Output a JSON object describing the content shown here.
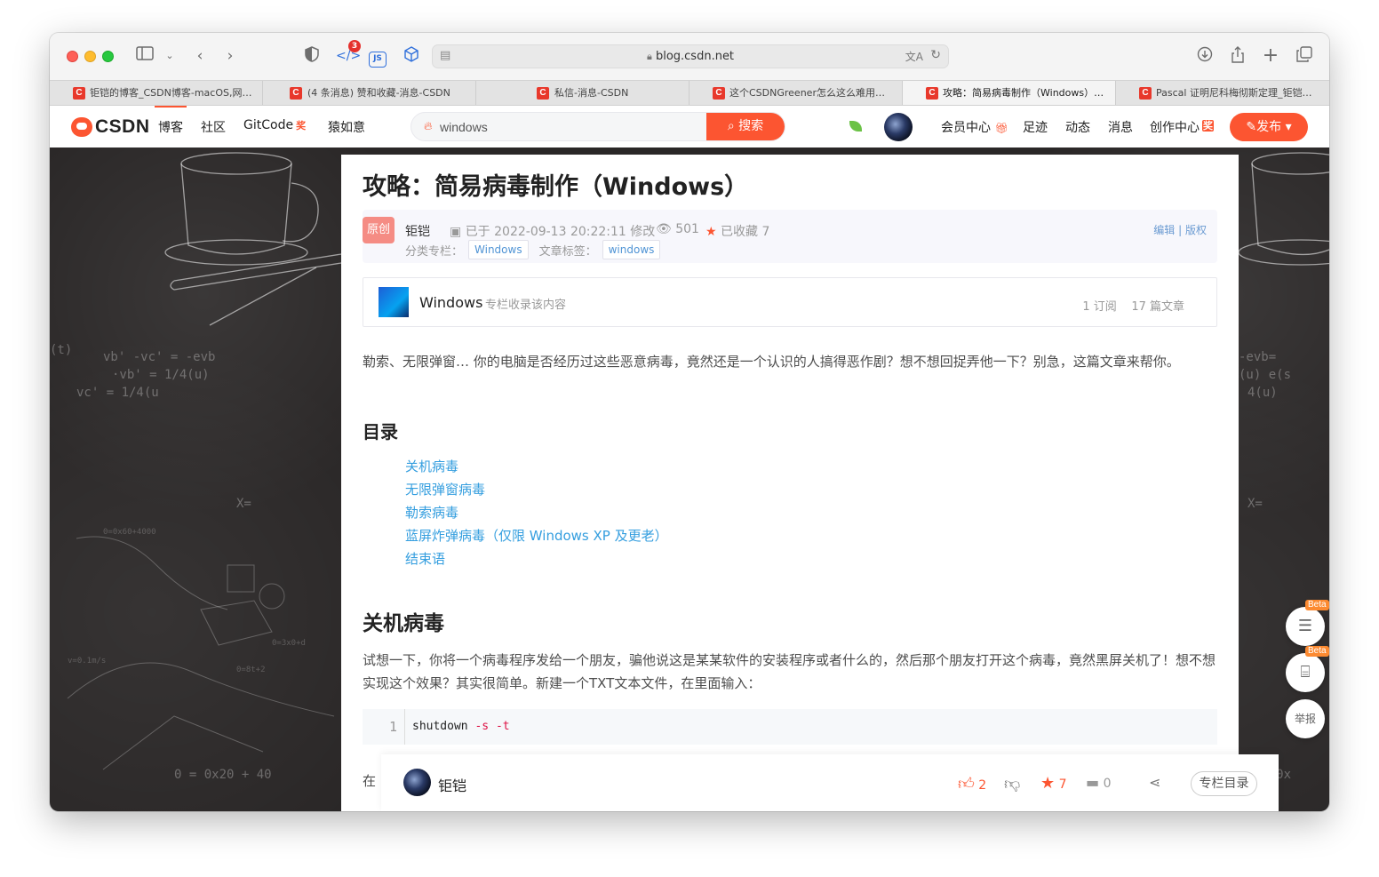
{
  "browser": {
    "address": "blog.csdn.net",
    "devtools_badge": "3",
    "js_label": "JS",
    "tabs": [
      {
        "label": "钜铠的博客_CSDN博客-macOS,网…",
        "active": false
      },
      {
        "label": "(4 条消息) 赞和收藏-消息-CSDN",
        "active": false
      },
      {
        "label": "私信-消息-CSDN",
        "active": false
      },
      {
        "label": "这个CSDNGreener怎么这么难用…",
        "active": false
      },
      {
        "label": "攻略：简易病毒制作（Windows）…",
        "active": true
      },
      {
        "label": "Pascal 证明尼科梅彻斯定理_钜铠…",
        "active": false
      }
    ]
  },
  "csdn_nav": {
    "logo": "CSDN",
    "links": [
      "博客",
      "社区",
      "GitCode",
      "猿如意"
    ],
    "jiang": "奖",
    "search_value": "windows",
    "search_button": "搜索",
    "right_links": [
      "会员中心",
      "足迹",
      "动态",
      "消息",
      "创作中心"
    ],
    "publish": "发布"
  },
  "article": {
    "title": "攻略：简易病毒制作（Windows）",
    "badge": "原创",
    "author": "钜铠",
    "date": "已于 2022-09-13 20:22:11 修改",
    "views": "501",
    "favorites": "已收藏 7",
    "edit": "编辑",
    "copyright": "版权",
    "category_label": "分类专栏：",
    "category": "Windows",
    "tag_label": "文章标签：",
    "tag": "windows",
    "column": {
      "name": "Windows",
      "subtitle": "专栏收录该内容",
      "subscribers": "1 订阅",
      "articles": "17 篇文章"
    },
    "intro": "勒索、无限弹窗… 你的电脑是否经历过这些恶意病毒，竟然还是一个认识的人搞得恶作剧？想不想回捉弄他一下？别急，这篇文章来帮你。",
    "toc_heading": "目录",
    "toc": [
      "关机病毒",
      "无限弹窗病毒",
      "勒索病毒",
      "蓝屏炸弹病毒（仅限 Windows XP 及更老）",
      "结束语"
    ],
    "section1_heading": "关机病毒",
    "section1_text": "试想一下，你将一个病毒程序发给一个朋友，骗他说这是某某软件的安装程序或者什么的，然后那个朋友打开这个病毒，竟然黑屏关机了！想不想实现这个效果？其实很简单。新建一个TXT文本文件，在里面输入：",
    "code_line_number": "1",
    "code_cmd": "shutdown",
    "code_flag1": "-s",
    "code_flag2": "-t",
    "cut_text": "在"
  },
  "bottom_bar": {
    "author": "钜铠",
    "likes": "2",
    "favorites": "7",
    "comments": "0",
    "column_toc": "专栏目录"
  },
  "side": {
    "beta1": "Beta",
    "beta2": "Beta",
    "report": "举报"
  },
  "colors": {
    "accent": "#fc5531",
    "link": "#349edf",
    "background": "#2a2727"
  }
}
